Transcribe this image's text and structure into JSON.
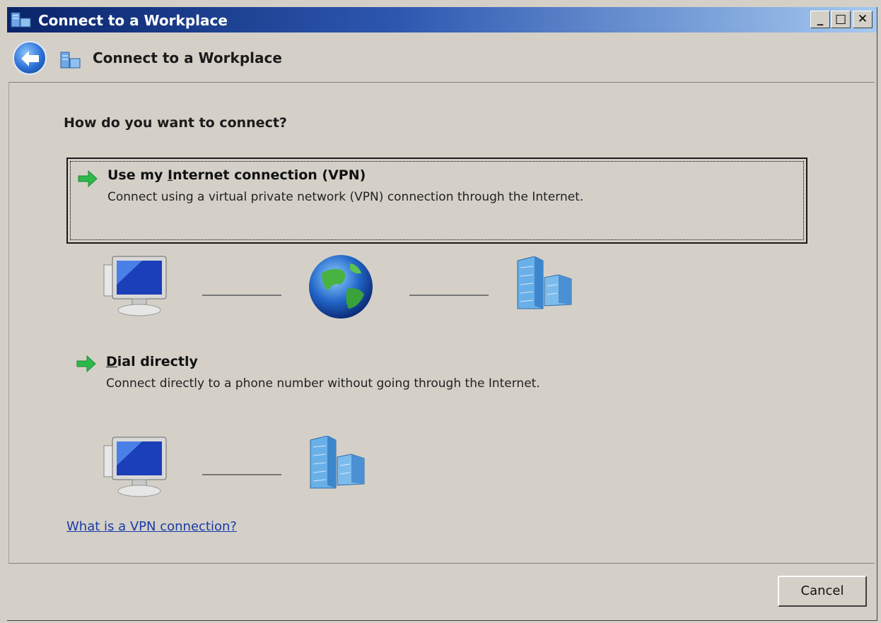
{
  "window": {
    "title": "Connect to a Workplace"
  },
  "titlebar_buttons": {
    "minimize": "_",
    "maximize": "□",
    "close": "✕"
  },
  "nav": {
    "title": "Connect to a Workplace"
  },
  "main": {
    "question": "How do you want to connect?",
    "options": [
      {
        "title_pre": "Use my ",
        "title_mnemonic": "I",
        "title_post": "nternet connection (VPN)",
        "description": "Connect using a virtual private network (VPN) connection through the Internet.",
        "selected": true
      },
      {
        "title_pre": "",
        "title_mnemonic": "D",
        "title_post": "ial directly",
        "description": "Connect directly to a phone number without going through the Internet.",
        "selected": false
      }
    ],
    "help_link": "What is a VPN connection?"
  },
  "footer": {
    "cancel_label": "Cancel"
  },
  "colors": {
    "accent": "#2d58b0",
    "link": "#1a3aa8",
    "arrow": "#2db84a"
  },
  "icons": [
    "workplace-icon",
    "back-arrow-icon",
    "green-arrow-icon",
    "computer-icon",
    "globe-icon",
    "building-icon"
  ]
}
